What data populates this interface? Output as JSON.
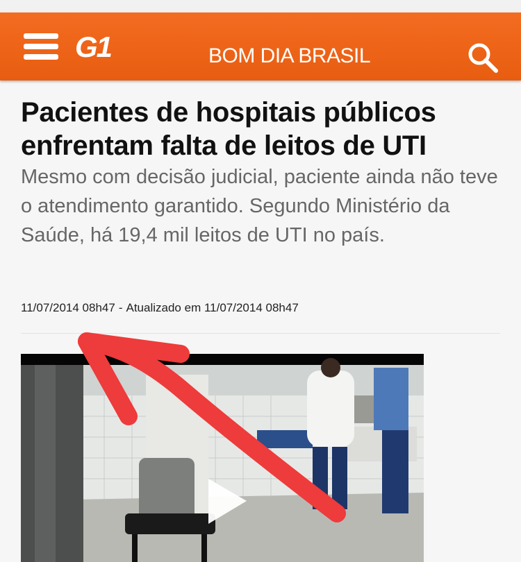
{
  "header": {
    "logo_text": "G1",
    "section_title": "BOM DIA BRASIL",
    "brand_color": "#f36c21",
    "menu_icon": "hamburger-menu-icon",
    "search_icon": "search-icon"
  },
  "article": {
    "headline": "Pacientes de hospitais públicos enfrentam falta de leitos de UTI",
    "subtitle": "Mesmo com decisão judicial, paciente ainda não teve o atendimento garantido. Segundo Ministério da Saúde, há 19,4 mil leitos de UTI no país.",
    "published": "11/07/2014 08h47",
    "separator": "-",
    "updated_prefix": "Atualizado em",
    "updated": "11/07/2014 08h47"
  },
  "video": {
    "play_icon": "play-icon"
  },
  "annotation": {
    "arrow_color": "#ee3b3b"
  }
}
